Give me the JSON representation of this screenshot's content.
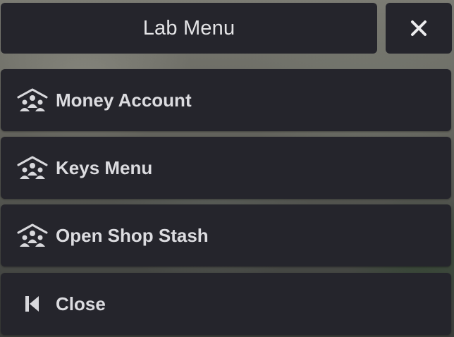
{
  "header": {
    "title": "Lab Menu",
    "close_icon": "close-icon"
  },
  "items": [
    {
      "label": "Money Account",
      "icon": "people-house-icon"
    },
    {
      "label": "Keys Menu",
      "icon": "people-house-icon"
    },
    {
      "label": "Open Shop Stash",
      "icon": "people-house-icon"
    },
    {
      "label": "Close",
      "icon": "skip-back-icon"
    }
  ],
  "colors": {
    "panel": "#25252c",
    "text": "#dcdce0"
  }
}
